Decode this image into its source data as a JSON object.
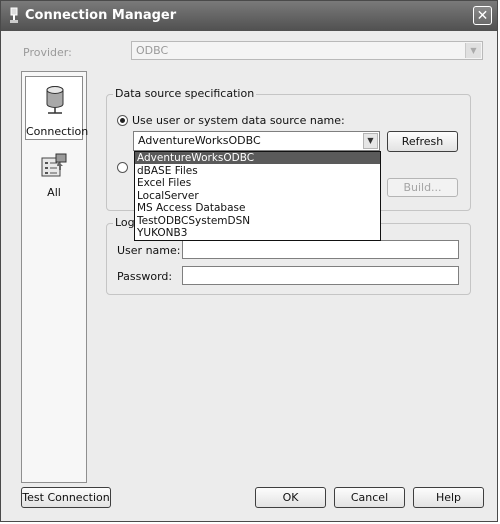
{
  "window": {
    "title": "Connection Manager",
    "close_glyph": "✕"
  },
  "provider": {
    "label": "Provider:",
    "value": "ODBC"
  },
  "nav": [
    {
      "label": "Connection",
      "icon": "database-cylinder-icon"
    },
    {
      "label": "All",
      "icon": "properties-list-icon"
    }
  ],
  "data_source": {
    "legend": "Data source specification",
    "use_dsn_label": "Use user or system data source name:",
    "selected_dsn": "AdventureWorksODBC",
    "refresh_label": "Refresh",
    "build_label": "Build...",
    "options": [
      "AdventureWorksODBC",
      "dBASE Files",
      "Excel Files",
      "LocalServer",
      "MS Access Database",
      "TestODBCSystemDSN",
      "YUKONB3"
    ]
  },
  "login": {
    "legend": "Logi",
    "username_label": "User name:",
    "password_label": "Password:",
    "username_value": "",
    "password_value": ""
  },
  "buttons": {
    "test_connection": "Test Connection",
    "ok": "OK",
    "cancel": "Cancel",
    "help": "Help"
  }
}
